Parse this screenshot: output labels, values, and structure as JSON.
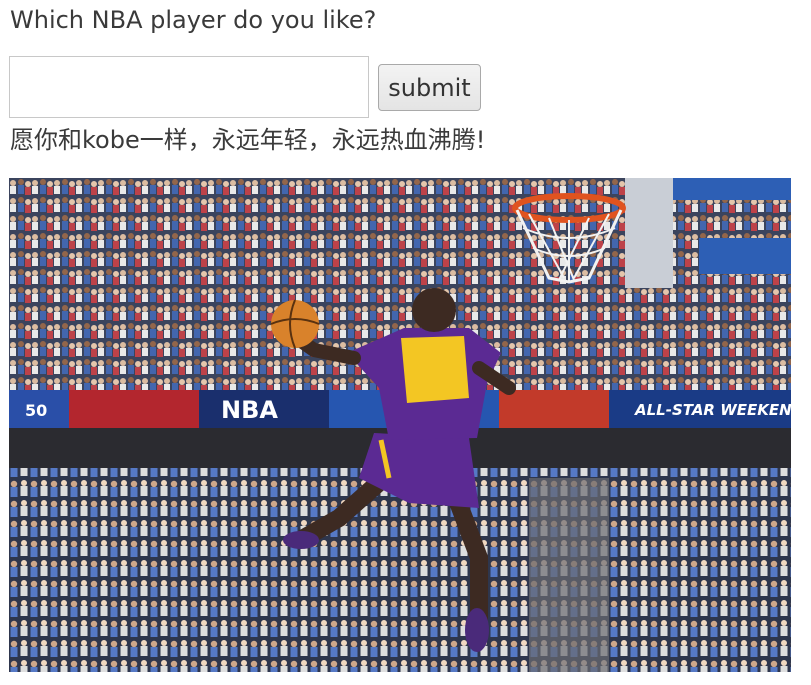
{
  "question": "Which NBA player do you like?",
  "input": {
    "value": "",
    "placeholder": ""
  },
  "submit_label": "submit",
  "result_text": "愿你和kobe一样，永远年轻，永远热血沸腾!",
  "photo": {
    "banner_left": "50",
    "banner_center": "NBA",
    "banner_right": "ALL-STAR WEEKEND"
  },
  "colors": {
    "jersey_purple": "#5b2a93",
    "jersey_gold": "#f3c623",
    "ball": "#d9822b",
    "rim": "#e0531f"
  }
}
